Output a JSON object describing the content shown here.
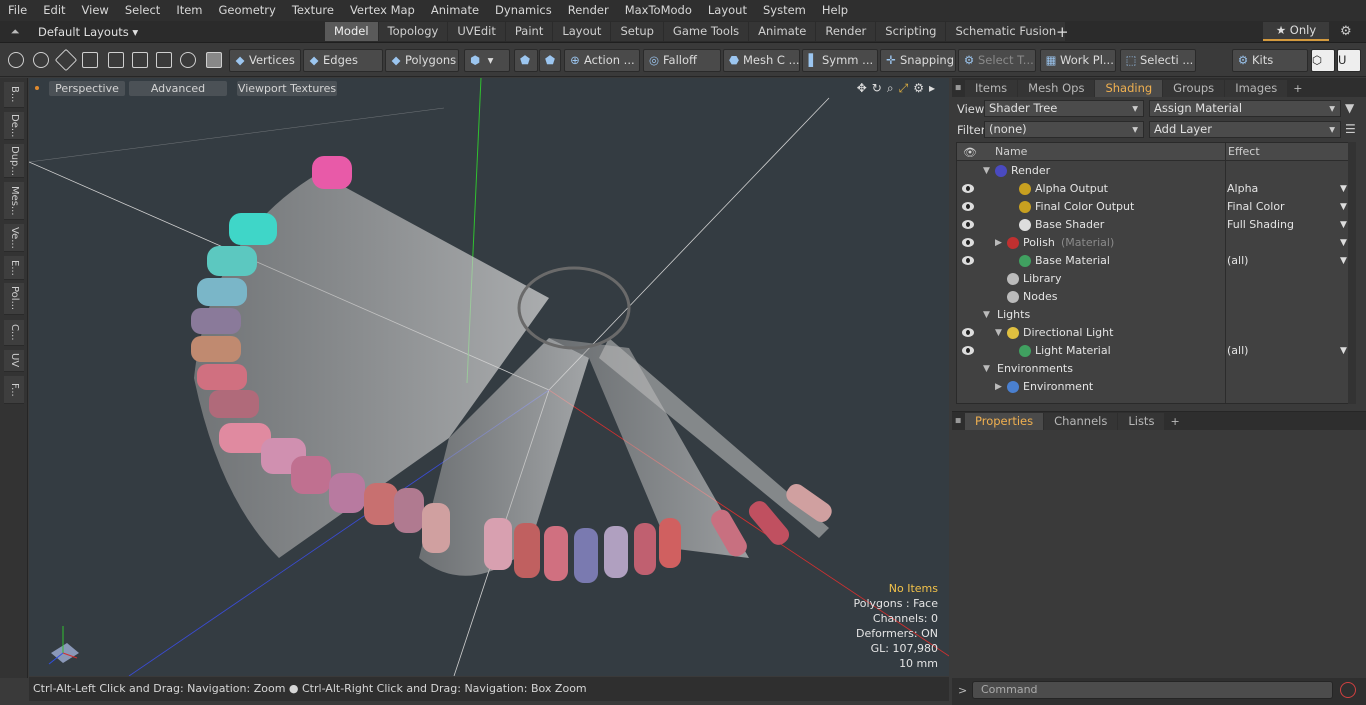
{
  "menu": [
    "File",
    "Edit",
    "View",
    "Select",
    "Item",
    "Geometry",
    "Texture",
    "Vertex Map",
    "Animate",
    "Dynamics",
    "Render",
    "MaxToModo",
    "Layout",
    "System",
    "Help"
  ],
  "layout": {
    "selector": "Default Layouts ▾",
    "tabs": [
      "Model",
      "Topology",
      "UVEdit",
      "Paint",
      "Layout",
      "Setup",
      "Game Tools",
      "Animate",
      "Render",
      "Scripting",
      "Schematic Fusion"
    ],
    "active_tab": "Model",
    "plus": "+",
    "only": "★  Only"
  },
  "toolbar": {
    "vertices": "Vertices",
    "edges": "Edges",
    "polygons": "Polygons",
    "action": "Action ...",
    "falloff": "Falloff",
    "meshc": "Mesh C ...",
    "symm": "Symm ...",
    "snapping": "Snapping",
    "select_t": "Select T...",
    "workpl": "Work Pl...",
    "selecti": "Selecti ...",
    "kits": "Kits"
  },
  "leftstrip": [
    "B...",
    "De...",
    "Dup...",
    "Mes...",
    "Ve...",
    "E...",
    "Pol...",
    "C...",
    "UV",
    "F..."
  ],
  "viewport": {
    "perspective": "Perspective",
    "advanced": "Advanced",
    "textures": "Viewport Textures"
  },
  "stats": {
    "items": "No Items",
    "polygons": "Polygons : Face",
    "channels": "Channels: 0",
    "deformers": "Deformers: ON",
    "gl": "GL: 107,980",
    "unit": "10 mm"
  },
  "status": "Ctrl-Alt-Left Click and Drag: Navigation: Zoom  ●  Ctrl-Alt-Right Click and Drag: Navigation: Box Zoom",
  "panel": {
    "tabs": [
      "Items",
      "Mesh Ops",
      "Shading",
      "Groups",
      "Images"
    ],
    "active_tab": "Shading",
    "plus": "+",
    "view_label": "View",
    "view_value": "Shader Tree",
    "assign": "Assign Material",
    "filter_label": "Filter",
    "filter_value": "(none)",
    "add_layer": "Add Layer",
    "col_name": "Name",
    "col_effect": "Effect",
    "tree": [
      {
        "label": "Render",
        "effect": "",
        "eye": false,
        "indent": 0,
        "arrow": "▼",
        "color": "#4a4ac0"
      },
      {
        "label": "Alpha Output",
        "effect": "Alpha",
        "eye": true,
        "indent": 2,
        "arrow": "",
        "color": "#c8a020"
      },
      {
        "label": "Final Color Output",
        "effect": "Final Color",
        "eye": true,
        "indent": 2,
        "arrow": "",
        "color": "#c8a020"
      },
      {
        "label": "Base Shader",
        "effect": "Full Shading",
        "eye": true,
        "indent": 2,
        "arrow": "",
        "color": "#dddddd"
      },
      {
        "label": "Polish",
        "sub": "(Material)",
        "effect": "",
        "eye": true,
        "indent": 1,
        "arrow": "▶",
        "color": "#c03030"
      },
      {
        "label": "Base Material",
        "effect": "(all)",
        "eye": true,
        "indent": 2,
        "arrow": "",
        "color": "#40a060"
      },
      {
        "label": "Library",
        "effect": "",
        "eye": false,
        "indent": 1,
        "arrow": "",
        "color": "#bbbbbb"
      },
      {
        "label": "Nodes",
        "effect": "",
        "eye": false,
        "indent": 1,
        "arrow": "",
        "color": "#bbbbbb"
      },
      {
        "label": "Lights",
        "effect": "",
        "eye": false,
        "indent": 0,
        "arrow": "▼",
        "color": ""
      },
      {
        "label": "Directional Light",
        "effect": "",
        "eye": true,
        "indent": 1,
        "arrow": "▼",
        "color": "#e0c040"
      },
      {
        "label": "Light Material",
        "effect": "(all)",
        "eye": true,
        "indent": 2,
        "arrow": "",
        "color": "#40a060"
      },
      {
        "label": "Environments",
        "effect": "",
        "eye": false,
        "indent": 0,
        "arrow": "▼",
        "color": ""
      },
      {
        "label": "Environment",
        "effect": "",
        "eye": false,
        "indent": 1,
        "arrow": "▶",
        "color": "#4a80d0"
      }
    ],
    "props_tabs": [
      "Properties",
      "Channels",
      "Lists"
    ],
    "props_active": "Properties",
    "command": "Command"
  }
}
